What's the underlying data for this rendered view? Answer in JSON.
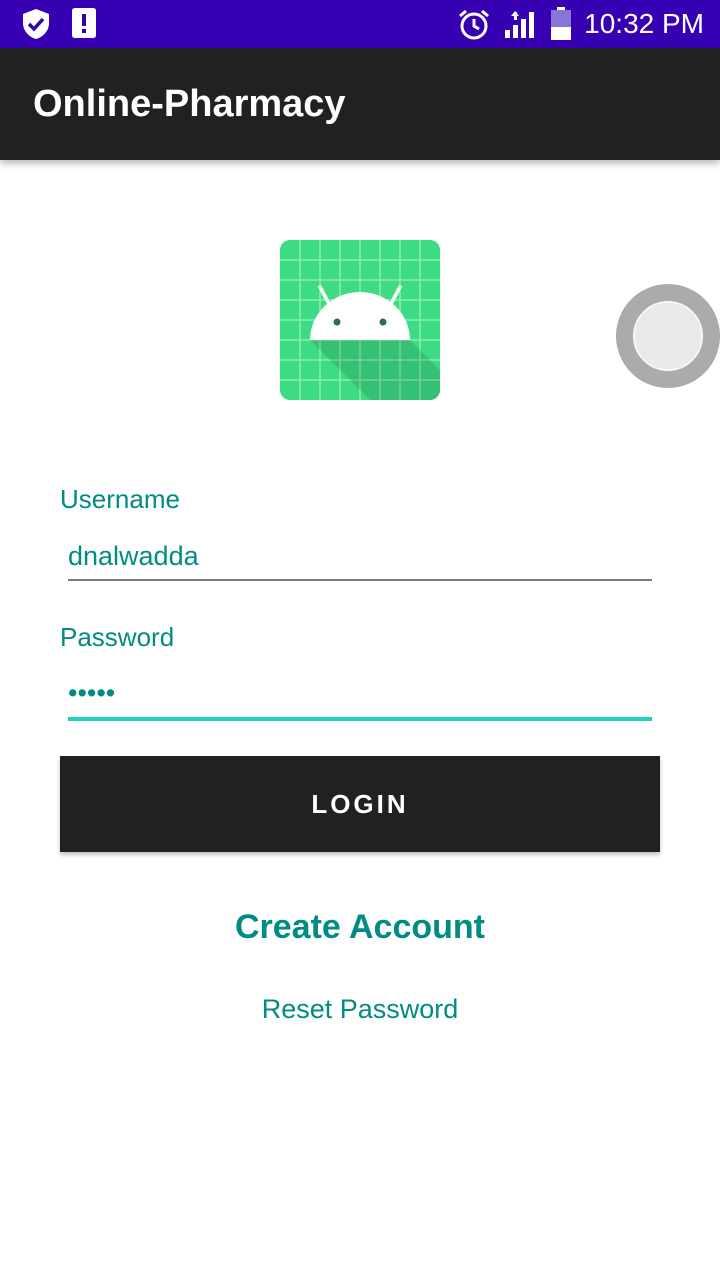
{
  "status_bar": {
    "time": "10:32 PM",
    "icons": [
      "shield-check-icon",
      "alert-icon",
      "alarm-icon",
      "signal-icon",
      "battery-icon"
    ],
    "background": "#3700b3"
  },
  "app_bar": {
    "title": "Online-Pharmacy",
    "background": "#212121"
  },
  "logo": {
    "icon": "android-app-icon",
    "color": "#3ddc84"
  },
  "form": {
    "username_label": "Username",
    "username_value": "dnalwadda",
    "password_label": "Password",
    "password_value": "•••••",
    "login_label": "LOGIN",
    "accent_color": "#008b83",
    "focus_color": "#1ad1c4"
  },
  "links": {
    "create_account": "Create Account",
    "reset_password": "Reset Password"
  }
}
